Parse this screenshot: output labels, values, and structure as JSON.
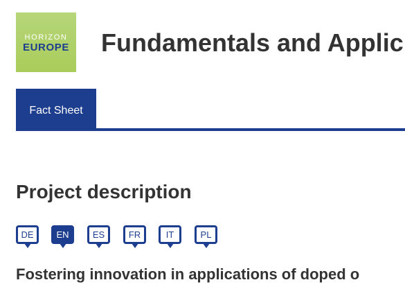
{
  "logo": {
    "line1": "HORIZON",
    "line2": "EUROPE"
  },
  "header": {
    "title": "Fundamentals and Applic"
  },
  "tabs": [
    {
      "label": "Fact Sheet",
      "active": true
    }
  ],
  "section": {
    "heading": "Project description"
  },
  "languages": [
    {
      "code": "DE",
      "selected": false
    },
    {
      "code": "EN",
      "selected": true
    },
    {
      "code": "ES",
      "selected": false
    },
    {
      "code": "FR",
      "selected": false
    },
    {
      "code": "IT",
      "selected": false
    },
    {
      "code": "PL",
      "selected": false
    }
  ],
  "description": {
    "title": "Fostering innovation in applications of doped o"
  },
  "colors": {
    "brand_blue": "#1d3d8f",
    "logo_green": "#a9cc5a",
    "text": "#333333"
  }
}
